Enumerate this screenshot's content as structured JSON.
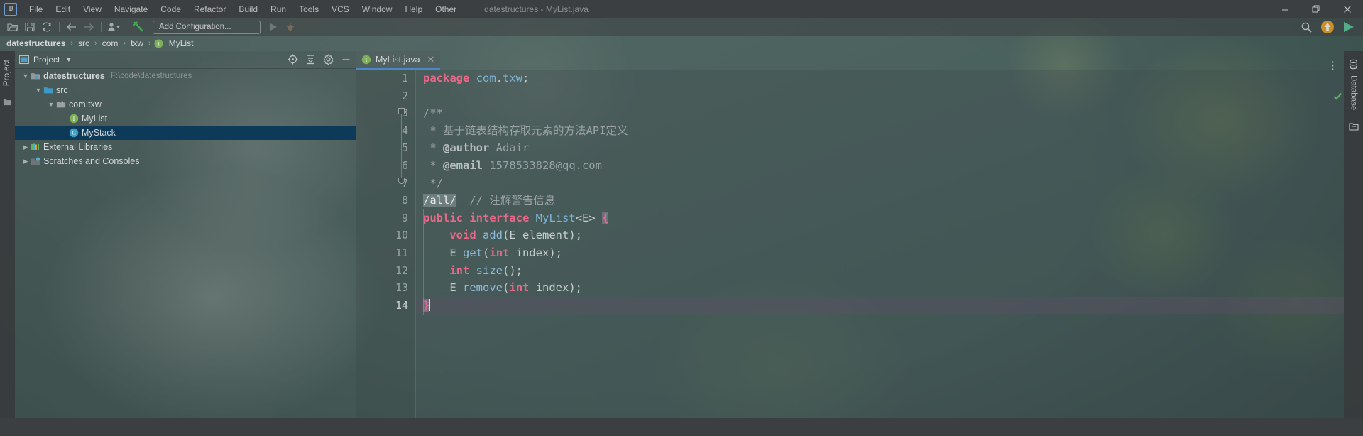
{
  "window": {
    "title": "datestructures - MyList.java",
    "logo_text": "IJ",
    "buttons": [
      {
        "name": "minimize",
        "glyph": "—"
      },
      {
        "name": "maximize",
        "glyph": "❐"
      },
      {
        "name": "close",
        "glyph": "✕"
      }
    ]
  },
  "menubar": {
    "items": [
      {
        "label": "File",
        "mnemonic": "F"
      },
      {
        "label": "Edit",
        "mnemonic": "E"
      },
      {
        "label": "View",
        "mnemonic": "V"
      },
      {
        "label": "Navigate",
        "mnemonic": "N"
      },
      {
        "label": "Code",
        "mnemonic": "C"
      },
      {
        "label": "Refactor",
        "mnemonic": "R"
      },
      {
        "label": "Build",
        "mnemonic": "B"
      },
      {
        "label": "Run",
        "mnemonic": "R"
      },
      {
        "label": "Tools",
        "mnemonic": "T"
      },
      {
        "label": "VCS",
        "mnemonic": "S"
      },
      {
        "label": "Window",
        "mnemonic": "W"
      },
      {
        "label": "Help",
        "mnemonic": "H"
      },
      {
        "label": "Other",
        "mnemonic": ""
      }
    ]
  },
  "toolbar": {
    "icons": [
      "open-folder-icon",
      "save-all-icon",
      "sync-refresh-icon",
      "back-arrow-icon",
      "forward-arrow-icon",
      "update-project-icon",
      "build-hammer-icon"
    ],
    "run_config_label": "Add Configuration...",
    "run_icon": "run-play-icon",
    "debug_icon": "debug-bug-icon",
    "search_icon": "search-icon",
    "update_icon": "update-badge-icon",
    "ide_icon": "ide-play-icon"
  },
  "breadcrumb": {
    "items": [
      {
        "label": "datestructures",
        "bold": true,
        "icon": ""
      },
      {
        "label": "src",
        "bold": false,
        "icon": ""
      },
      {
        "label": "com",
        "bold": false,
        "icon": ""
      },
      {
        "label": "txw",
        "bold": false,
        "icon": ""
      },
      {
        "label": "MyList",
        "bold": false,
        "icon": "interface-icon"
      }
    ],
    "separator": "›"
  },
  "left_strip": {
    "label": "Project",
    "structure_icon": "structure-folder-icon"
  },
  "project_panel": {
    "header_title": "Project",
    "header_icon": "project-view-icon",
    "dropdown_icon": "chevron-down-icon",
    "actions": [
      "locate-target-icon",
      "collapse-all-icon",
      "settings-gear-icon",
      "hide-minimize-icon"
    ],
    "tree": [
      {
        "label": "datestructures",
        "path": "F:\\code\\datestructures",
        "indent": 0,
        "arrow": "∨",
        "icon": "module-folder-icon",
        "bold": true,
        "selected": false
      },
      {
        "label": "src",
        "path": "",
        "indent": 1,
        "arrow": "∨",
        "icon": "source-folder-icon",
        "bold": false,
        "selected": false
      },
      {
        "label": "com.txw",
        "path": "",
        "indent": 2,
        "arrow": "∨",
        "icon": "package-icon",
        "bold": false,
        "selected": false
      },
      {
        "label": "MyList",
        "path": "",
        "indent": 3,
        "arrow": "",
        "icon": "interface-icon",
        "bold": false,
        "selected": false
      },
      {
        "label": "MyStack",
        "path": "",
        "indent": 3,
        "arrow": "",
        "icon": "class-icon",
        "bold": false,
        "selected": true
      },
      {
        "label": "External Libraries",
        "path": "",
        "indent": 0,
        "arrow": "›",
        "icon": "libraries-icon",
        "bold": false,
        "selected": false
      },
      {
        "label": "Scratches and Consoles",
        "path": "",
        "indent": 0,
        "arrow": "›",
        "icon": "scratches-icon",
        "bold": false,
        "selected": false
      }
    ]
  },
  "editor": {
    "tab": {
      "label": "MyList.java",
      "icon": "interface-icon",
      "close_icon": "close-icon"
    },
    "tab_actions_icon": "more-options-icon",
    "inspection_status_icon": "ok-check-icon",
    "lines": [
      {
        "n": "1",
        "text": "package com.txw;"
      },
      {
        "n": "2",
        "text": ""
      },
      {
        "n": "3",
        "text": "/**"
      },
      {
        "n": "4",
        "text": " * 基于链表结构存取元素的方法API定义"
      },
      {
        "n": "5",
        "text": " * @author Adair"
      },
      {
        "n": "6",
        "text": " * @email 1578533828@qq.com"
      },
      {
        "n": "7",
        "text": " */"
      },
      {
        "n": "8",
        "text": "/all/  // 注解警告信息"
      },
      {
        "n": "9",
        "text": "public interface MyList<E> {"
      },
      {
        "n": "10",
        "text": "    void add(E element);"
      },
      {
        "n": "11",
        "text": "    E get(int index);"
      },
      {
        "n": "12",
        "text": "    int size();"
      },
      {
        "n": "13",
        "text": "    E remove(int index);"
      },
      {
        "n": "14",
        "text": "}"
      }
    ],
    "current_line": "14"
  },
  "right_strip": {
    "label": "Database",
    "icon": "database-icon",
    "secondary_icon": "maven-icon"
  },
  "colors": {
    "keyword": "#e8698a",
    "class_name": "#7fb3d5",
    "comment": "#9aa2a6",
    "selection": "#0d3a58",
    "tab_underline": "#4a88c7",
    "ok_green": "#5fb85f",
    "titlebar": "#3c3f41"
  }
}
